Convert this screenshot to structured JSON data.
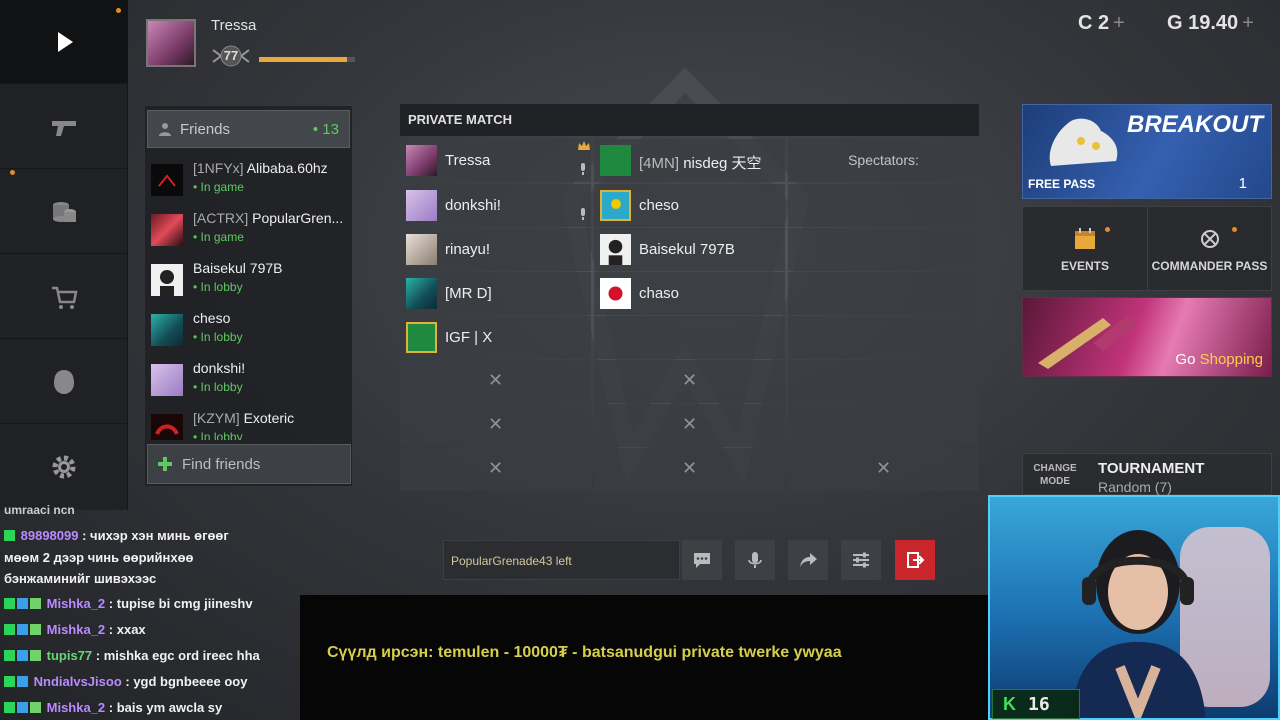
{
  "profile": {
    "name": "Tressa",
    "level": "77",
    "xp_progress": 0.92
  },
  "currency": {
    "c_label": "C",
    "c_value": "2",
    "g_label": "G",
    "g_value": "19.40",
    "plus": "+"
  },
  "nav": {
    "items": [
      "play-icon",
      "weapons-icon",
      "coins-icon",
      "shop-icon",
      "armor-icon",
      "settings-icon"
    ]
  },
  "friends": {
    "header": "Friends",
    "count": "• 13",
    "list": [
      {
        "tag": "[1NFYx]",
        "name": "Alibaba.60hz",
        "status": "• In game"
      },
      {
        "tag": "[ACTRX]",
        "name": "PopularGren...",
        "status": "• In game"
      },
      {
        "tag": "",
        "name": "Baisekul 797B",
        "status": "• In lobby"
      },
      {
        "tag": "",
        "name": "cheso",
        "status": "• In lobby"
      },
      {
        "tag": "",
        "name": "donkshi!",
        "status": "• In lobby"
      },
      {
        "tag": "[KZYM]",
        "name": "Exoteric",
        "status": "• In lobby"
      }
    ],
    "find_label": "Find friends"
  },
  "match": {
    "title": "PRIVATE MATCH",
    "team_a": [
      {
        "tag": "",
        "name": "Tressa"
      },
      {
        "tag": "",
        "name": "donkshi!"
      },
      {
        "tag": "",
        "name": "rinayu!"
      },
      {
        "tag": "",
        "name": "[MR D]"
      },
      {
        "tag": "",
        "name": "IGF | X"
      }
    ],
    "team_b": [
      {
        "tag": "[4MN]",
        "name": "nisdeg 天空"
      },
      {
        "tag": "",
        "name": "cheso"
      },
      {
        "tag": "",
        "name": "Baisekul 797B"
      },
      {
        "tag": "",
        "name": "chaso"
      }
    ],
    "spectators_label": "Spectators:",
    "empty_mark": "✕",
    "chat_message": "PopularGrenade43 left"
  },
  "right": {
    "breakout_title": "BREAKOUT",
    "free_pass": "FREE PASS",
    "pass_count": "1",
    "events_label": "EVENTS",
    "commander_label": "COMMANDER PASS",
    "shop_label_go": "Go",
    "shop_label_shop": "Shopping",
    "change_mode": "CHANGE MODE",
    "tournament_title": "TOURNAMENT",
    "tournament_sub": "Random (7)"
  },
  "stream": {
    "chat_top_cut": "umraaci ncn",
    "chat": [
      {
        "user": "89898099",
        "text": ": чихэр хэн минь өгөөг"
      },
      {
        "user": "",
        "text": "мөөм 2 дээр чинь өөрийнхөө"
      },
      {
        "user": "",
        "text": "бэнжаминийг шивэхээс"
      },
      {
        "user": "Mishka_2",
        "text": ": tupise bi cmg jiineshv"
      },
      {
        "user": "Mishka_2",
        "text": ": xxax"
      },
      {
        "user": "tupis77",
        "text": ": mishka egc ord ireec hha"
      },
      {
        "user": "NndialvsJisoo",
        "text": ": ygd bgnbeeee ooy"
      },
      {
        "user": "Mishka_2",
        "text": ": bais ym awcla sy"
      }
    ],
    "ticker": "Сүүлд ирсэн: temulen - 10000₮ - batsanudgui private twerke ywyaa",
    "sub_icon": "K",
    "sub_count": "16"
  }
}
